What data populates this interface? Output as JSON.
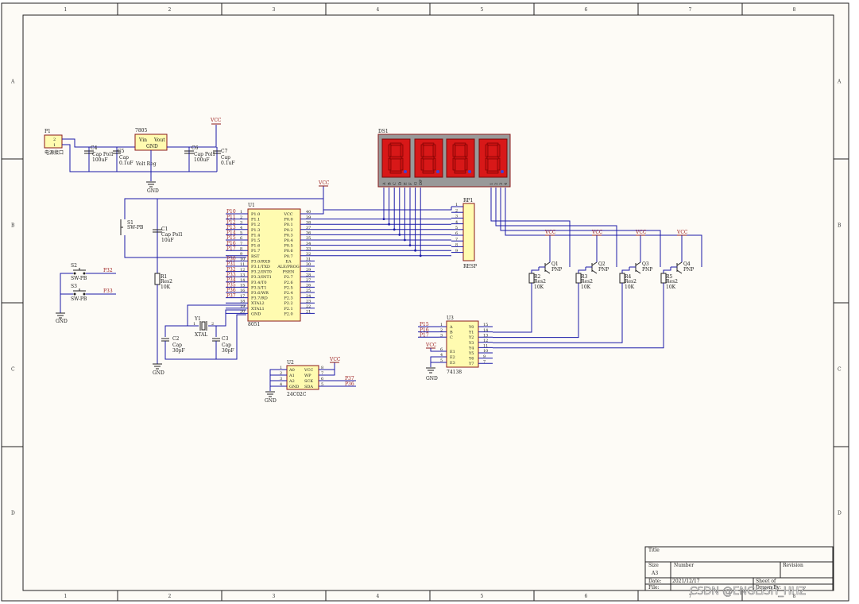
{
  "sheet": {
    "zone_cols": [
      "1",
      "2",
      "3",
      "4",
      "5",
      "6",
      "7",
      "8"
    ],
    "zone_rows": [
      "A",
      "B",
      "C",
      "D"
    ]
  },
  "title_block": {
    "title_label": "Title",
    "size_label": "Size",
    "size_value": "A3",
    "number_label": "Number",
    "revision_label": "Revision",
    "date_label": "Date:",
    "date_value": "2021/12/17",
    "file_label": "File:",
    "sheet_label": "Sheet  of",
    "drawn_label": "Drawn By:"
  },
  "watermark": "CSDN @ENGLISH_HHZ",
  "power": {
    "p1_ref": "P1",
    "p1_value": "电源接口",
    "p1_pin1": "1",
    "p1_pin2": "2",
    "c4_ref": "C4",
    "c4_type": "Cap Pol1",
    "c4_value": "100uF",
    "c5_ref": "C5",
    "c5_type": "Cap",
    "c5_value": "0.1uF",
    "reg_ref": "7805",
    "reg_vin": "Vin",
    "reg_vout": "Vout",
    "reg_gnd": "GND",
    "reg_value": "Volt Reg",
    "c6_ref": "C6",
    "c6_type": "Cap Pol1",
    "c6_value": "100uF",
    "c7_ref": "C7",
    "c7_type": "Cap",
    "c7_value": "0.1uF",
    "vcc": "VCC",
    "gnd": "GND"
  },
  "reset": {
    "s1_ref": "S1",
    "s1_value": "SW-PB",
    "c1_ref": "C1",
    "c1_type": "Cap Pol1",
    "c1_value": "10uF",
    "r1_ref": "R1",
    "r1_type": "Res2",
    "r1_value": "10K",
    "vcc": "VCC"
  },
  "buttons": {
    "s2_ref": "S2",
    "s2_value": "SW-PB",
    "s2_net": "P32",
    "s3_ref": "S3",
    "s3_value": "SW-PB",
    "s3_net": "P33",
    "gnd": "GND"
  },
  "crystal": {
    "y1_ref": "Y1",
    "y1_value": "XTAL",
    "pin1": "1",
    "pin2": "2",
    "c2_ref": "C2",
    "c2_type": "Cap",
    "c2_value": "30pF",
    "c3_ref": "C3",
    "c3_type": "Cap",
    "c3_value": "30pF",
    "gnd": "GND"
  },
  "mcu": {
    "ref": "U1",
    "value": "8051",
    "left_pins": [
      {
        "net": "P10",
        "num": "1",
        "name": "P1.0"
      },
      {
        "net": "P11",
        "num": "2",
        "name": "P1.1"
      },
      {
        "net": "P12",
        "num": "3",
        "name": "P1.2"
      },
      {
        "net": "P13",
        "num": "4",
        "name": "P1.3"
      },
      {
        "net": "P14",
        "num": "5",
        "name": "P1.4"
      },
      {
        "net": "P15",
        "num": "6",
        "name": "P1.5"
      },
      {
        "net": "P16",
        "num": "7",
        "name": "P1.6"
      },
      {
        "net": "P17",
        "num": "8",
        "name": "P1.7"
      },
      {
        "net": "",
        "num": "9",
        "name": "RST"
      },
      {
        "net": "P30",
        "num": "10",
        "name": "P3.0/RXD"
      },
      {
        "net": "P31",
        "num": "11",
        "name": "P3.1/TXD"
      },
      {
        "net": "P32",
        "num": "12",
        "name": "P3.2/INT0"
      },
      {
        "net": "P33",
        "num": "13",
        "name": "P3.3/INT1"
      },
      {
        "net": "P34",
        "num": "14",
        "name": "P3.4/T0"
      },
      {
        "net": "P35",
        "num": "15",
        "name": "P3.5/T1"
      },
      {
        "net": "P36",
        "num": "16",
        "name": "P3.6/WR"
      },
      {
        "net": "P37",
        "num": "17",
        "name": "P3.7/RD"
      },
      {
        "net": "",
        "num": "18",
        "name": "XTAL2"
      },
      {
        "net": "",
        "num": "19",
        "name": "XTAL1"
      },
      {
        "net": "",
        "num": "20",
        "name": "GND"
      }
    ],
    "right_pins": [
      {
        "num": "40",
        "name": "VCC"
      },
      {
        "num": "39",
        "name": "P0.0"
      },
      {
        "num": "38",
        "name": "P0.1"
      },
      {
        "num": "37",
        "name": "P0.2"
      },
      {
        "num": "36",
        "name": "P0.3"
      },
      {
        "num": "35",
        "name": "P0.4"
      },
      {
        "num": "34",
        "name": "P0.5"
      },
      {
        "num": "33",
        "name": "P0.6"
      },
      {
        "num": "32",
        "name": "P0.7"
      },
      {
        "num": "31",
        "name": "EA"
      },
      {
        "num": "30",
        "name": "ALE/PROG"
      },
      {
        "num": "29",
        "name": "PSEN"
      },
      {
        "num": "28",
        "name": "P2.7"
      },
      {
        "num": "27",
        "name": "P2.6"
      },
      {
        "num": "26",
        "name": "P2.5"
      },
      {
        "num": "25",
        "name": "P2.4"
      },
      {
        "num": "24",
        "name": "P2.3"
      },
      {
        "num": "23",
        "name": "P2.2"
      },
      {
        "num": "22",
        "name": "P2.1"
      },
      {
        "num": "21",
        "name": "P2.0"
      }
    ],
    "vcc": "VCC"
  },
  "display": {
    "ref": "DS1",
    "seg_pins": [
      "A",
      "B",
      "C",
      "D",
      "E",
      "F",
      "G",
      "DP"
    ],
    "digit_pins": [
      "1",
      "2",
      "3",
      "4"
    ],
    "segment_color": "#cc1111",
    "body_color": "#999999"
  },
  "resnet": {
    "ref": "RP1",
    "value": "RESP",
    "pins": [
      "1",
      "2",
      "3",
      "4",
      "5",
      "6",
      "7",
      "8",
      "9"
    ]
  },
  "drivers": [
    {
      "q": "Q1",
      "qtype": "PNP",
      "r": "R2",
      "rtype": "Res2",
      "rval": "10K",
      "vcc": "VCC"
    },
    {
      "q": "Q2",
      "qtype": "PNP",
      "r": "R3",
      "rtype": "Res2",
      "rval": "10K",
      "vcc": "VCC"
    },
    {
      "q": "Q3",
      "qtype": "PNP",
      "r": "R4",
      "rtype": "Res2",
      "rval": "10K",
      "vcc": "VCC"
    },
    {
      "q": "Q4",
      "qtype": "PNP",
      "r": "R5",
      "rtype": "Res2",
      "rval": "10K",
      "vcc": "VCC"
    }
  ],
  "decoder": {
    "ref": "U3",
    "value": "74138",
    "left_pins": [
      {
        "net": "P15",
        "num": "1",
        "name": "A"
      },
      {
        "net": "P16",
        "num": "2",
        "name": "B"
      },
      {
        "net": "P17",
        "num": "3",
        "name": "C"
      },
      {
        "net": "",
        "num": "6",
        "name": "E1"
      },
      {
        "net": "",
        "num": "4",
        "name": "E2"
      },
      {
        "net": "",
        "num": "5",
        "name": "E3"
      }
    ],
    "right_pins": [
      {
        "num": "15",
        "name": "Y0"
      },
      {
        "num": "14",
        "name": "Y1"
      },
      {
        "num": "13",
        "name": "Y2"
      },
      {
        "num": "12",
        "name": "Y3"
      },
      {
        "num": "11",
        "name": "Y4"
      },
      {
        "num": "10",
        "name": "Y5"
      },
      {
        "num": "9",
        "name": "Y6"
      },
      {
        "num": "7",
        "name": "Y7"
      }
    ],
    "vcc": "VCC",
    "gnd": "GND"
  },
  "eeprom": {
    "ref": "U2",
    "value": "24C02C",
    "left_pins": [
      {
        "num": "1",
        "name": "A0"
      },
      {
        "num": "2",
        "name": "A1"
      },
      {
        "num": "3",
        "name": "A2"
      },
      {
        "num": "4",
        "name": "GND"
      }
    ],
    "right_pins": [
      {
        "num": "8",
        "name": "VCC",
        "net": ""
      },
      {
        "num": "7",
        "name": "WP",
        "net": ""
      },
      {
        "num": "6",
        "name": "SCK",
        "net": "P37"
      },
      {
        "num": "5",
        "name": "SDA",
        "net": "P36"
      }
    ],
    "vcc": "VCC",
    "gnd": "GND"
  }
}
